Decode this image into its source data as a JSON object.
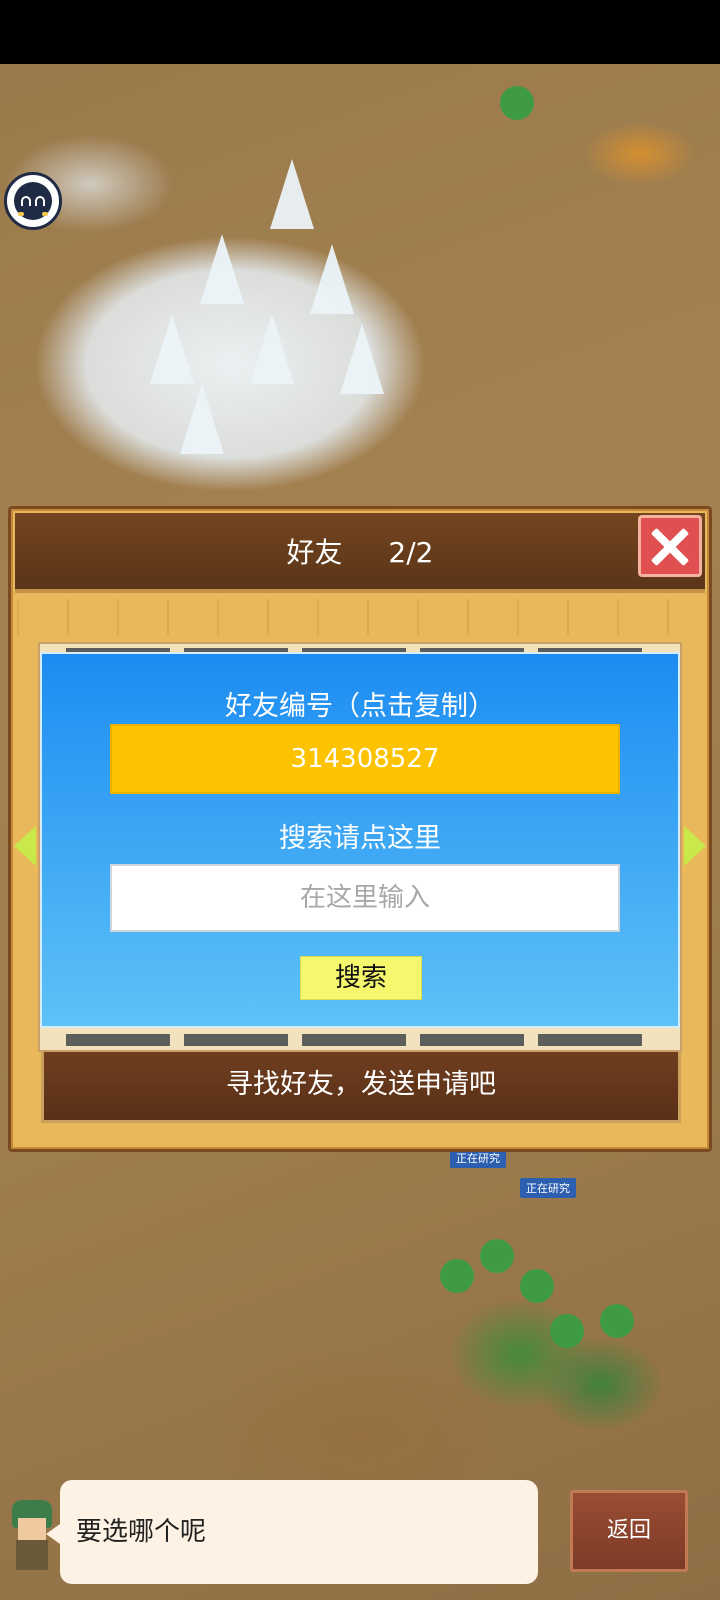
{
  "dialog": {
    "title": "好友",
    "page_indicator": "2/2"
  },
  "panel": {
    "friend_code_label": "好友编号（点击复制）",
    "friend_code": "314308527",
    "search_hint": "搜索请点这里",
    "search_placeholder": "在这里输入",
    "search_button": "搜索"
  },
  "banner": {
    "text": "寻找好友，发送申请吧"
  },
  "background": {
    "research_label_1": "正在研究",
    "research_label_2": "正在研究"
  },
  "speech": {
    "text": "要选哪个呢"
  },
  "back_button": {
    "label": "返回"
  },
  "icons": {
    "avatar": "smiley-face-icon",
    "close": "close-x-icon",
    "prev": "arrow-left-icon",
    "next": "arrow-right-icon"
  },
  "colors": {
    "panel_blue": "#1c8cf2",
    "code_yellow": "#fdc300",
    "close_red": "#e05050",
    "arrow_green": "#c9e84a"
  }
}
